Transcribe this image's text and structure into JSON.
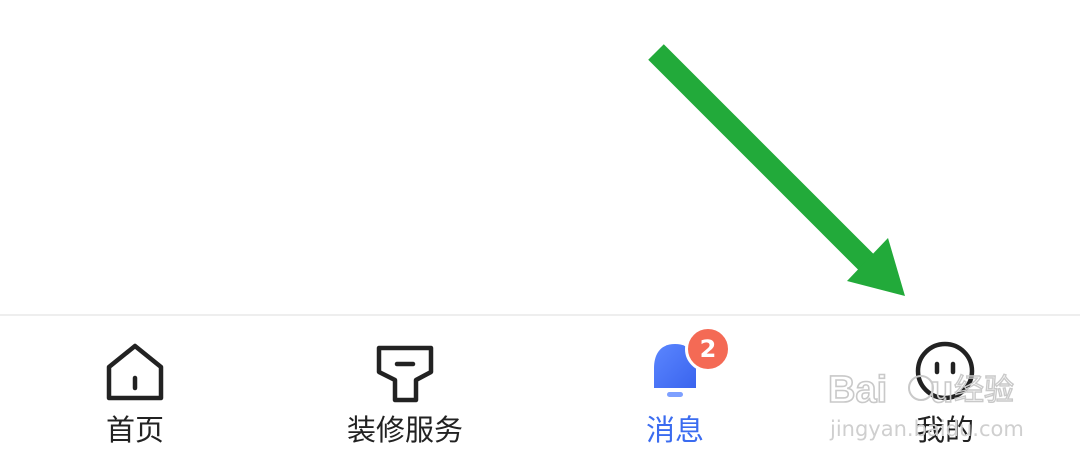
{
  "tabbar": {
    "tabs": [
      {
        "label": "首页",
        "icon": "home-icon",
        "active": false
      },
      {
        "label": "装修服务",
        "icon": "tag-icon",
        "active": false
      },
      {
        "label": "消息",
        "icon": "bell-icon",
        "active": true,
        "badge": "2"
      },
      {
        "label": "我的",
        "icon": "smiley-face-icon",
        "active": false
      }
    ]
  },
  "watermark": {
    "line1": "Baidu 经验",
    "line2": "jingyan.baidu.com"
  },
  "colors": {
    "active": "#3b6cf0",
    "badge": "#f46a55",
    "arrow": "#22aa3a",
    "text": "#222222"
  }
}
